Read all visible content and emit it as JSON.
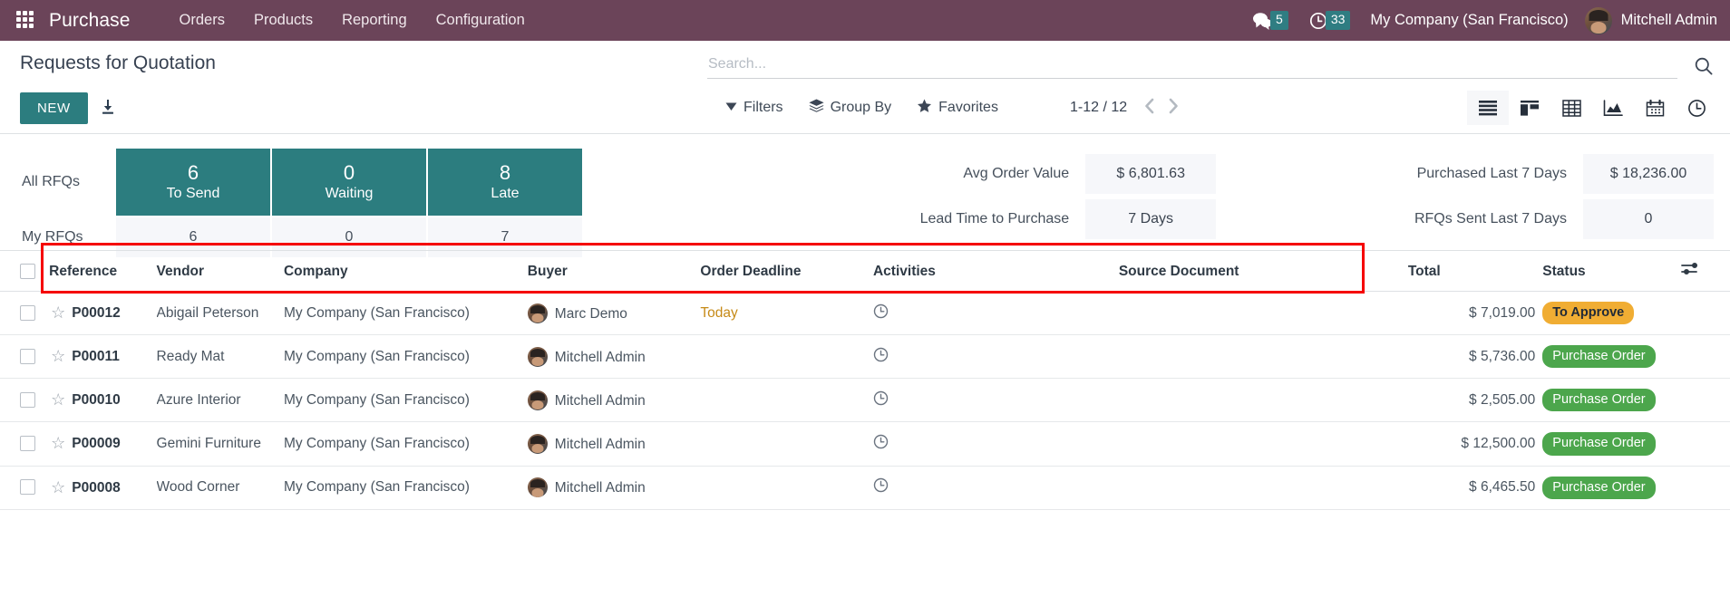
{
  "navbar": {
    "apps_icon": "apps-grid-icon",
    "brand": "Purchase",
    "menus": [
      "Orders",
      "Products",
      "Reporting",
      "Configuration"
    ],
    "messages_icon": "chat-bubble-icon",
    "messages_count": "5",
    "activities_icon": "clock-icon",
    "activities_count": "33",
    "company": "My Company (San Francisco)",
    "user": "Mitchell Admin",
    "bg_color": "#6B4459",
    "badge_color": "#2F7D82"
  },
  "control_panel": {
    "title": "Requests for Quotation",
    "new_button": "NEW",
    "download_icon": "download-icon",
    "search_placeholder": "Search...",
    "search_icon": "search-icon",
    "filters": "Filters",
    "group_by": "Group By",
    "favorites": "Favorites",
    "pager": "1-12 / 12",
    "pager_prev_icon": "chevron-left-icon",
    "pager_next_icon": "chevron-right-icon",
    "views": [
      {
        "name": "list-view",
        "icon": "list-icon",
        "active": true
      },
      {
        "name": "kanban-view",
        "icon": "kanban-icon",
        "active": false
      },
      {
        "name": "pivot-view",
        "icon": "pivot-table-icon",
        "active": false
      },
      {
        "name": "graph-view",
        "icon": "area-chart-icon",
        "active": false
      },
      {
        "name": "calendar-view",
        "icon": "calendar-icon",
        "active": false
      },
      {
        "name": "activity-view",
        "icon": "clock-icon",
        "active": false
      }
    ]
  },
  "kpi": {
    "row_labels": [
      "All RFQs",
      "My RFQs"
    ],
    "tiles": [
      {
        "label": "To Send",
        "all": "6",
        "mine": "6"
      },
      {
        "label": "Waiting",
        "all": "0",
        "mine": "0"
      },
      {
        "label": "Late",
        "all": "8",
        "mine": "7"
      }
    ],
    "metrics": [
      {
        "label": "Avg Order Value",
        "value": "$ 6,801.63"
      },
      {
        "label": "Purchased Last 7 Days",
        "value": "$ 18,236.00"
      },
      {
        "label": "Lead Time to Purchase",
        "value": "7 Days"
      },
      {
        "label": "RFQs Sent Last 7 Days",
        "value": "0"
      }
    ],
    "tile_color": "#2C7D7F"
  },
  "table": {
    "columns": [
      "Reference",
      "Vendor",
      "Company",
      "Buyer",
      "Order Deadline",
      "Activities",
      "Source Document",
      "Total",
      "Status"
    ],
    "optional_columns_icon": "column-settings-icon",
    "rows": [
      {
        "reference": "P00012",
        "vendor": "Abigail Peterson",
        "company": "My Company (San Francisco)",
        "buyer": "Marc Demo",
        "deadline": "Today",
        "deadline_highlight": true,
        "activity_icon": "clock-icon",
        "source_document": "",
        "total": "$ 7,019.00",
        "status": "To Approve",
        "status_type": "warning",
        "highlighted": true
      },
      {
        "reference": "P00011",
        "vendor": "Ready Mat",
        "company": "My Company (San Francisco)",
        "buyer": "Mitchell Admin",
        "deadline": "",
        "deadline_highlight": false,
        "activity_icon": "clock-icon",
        "source_document": "",
        "total": "$ 5,736.00",
        "status": "Purchase Order",
        "status_type": "success",
        "highlighted": false
      },
      {
        "reference": "P00010",
        "vendor": "Azure Interior",
        "company": "My Company (San Francisco)",
        "buyer": "Mitchell Admin",
        "deadline": "",
        "deadline_highlight": false,
        "activity_icon": "clock-icon",
        "source_document": "",
        "total": "$ 2,505.00",
        "status": "Purchase Order",
        "status_type": "success",
        "highlighted": false
      },
      {
        "reference": "P00009",
        "vendor": "Gemini Furniture",
        "company": "My Company (San Francisco)",
        "buyer": "Mitchell Admin",
        "deadline": "",
        "deadline_highlight": false,
        "activity_icon": "clock-icon",
        "source_document": "",
        "total": "$ 12,500.00",
        "status": "Purchase Order",
        "status_type": "success",
        "highlighted": false
      },
      {
        "reference": "P00008",
        "vendor": "Wood Corner",
        "company": "My Company (San Francisco)",
        "buyer": "Mitchell Admin",
        "deadline": "",
        "deadline_highlight": false,
        "activity_icon": "clock-icon",
        "source_document": "",
        "total": "$ 6,465.50",
        "status": "Purchase Order",
        "status_type": "success",
        "highlighted": false
      }
    ]
  },
  "annotation": {
    "highlight_color": "#F50000"
  }
}
